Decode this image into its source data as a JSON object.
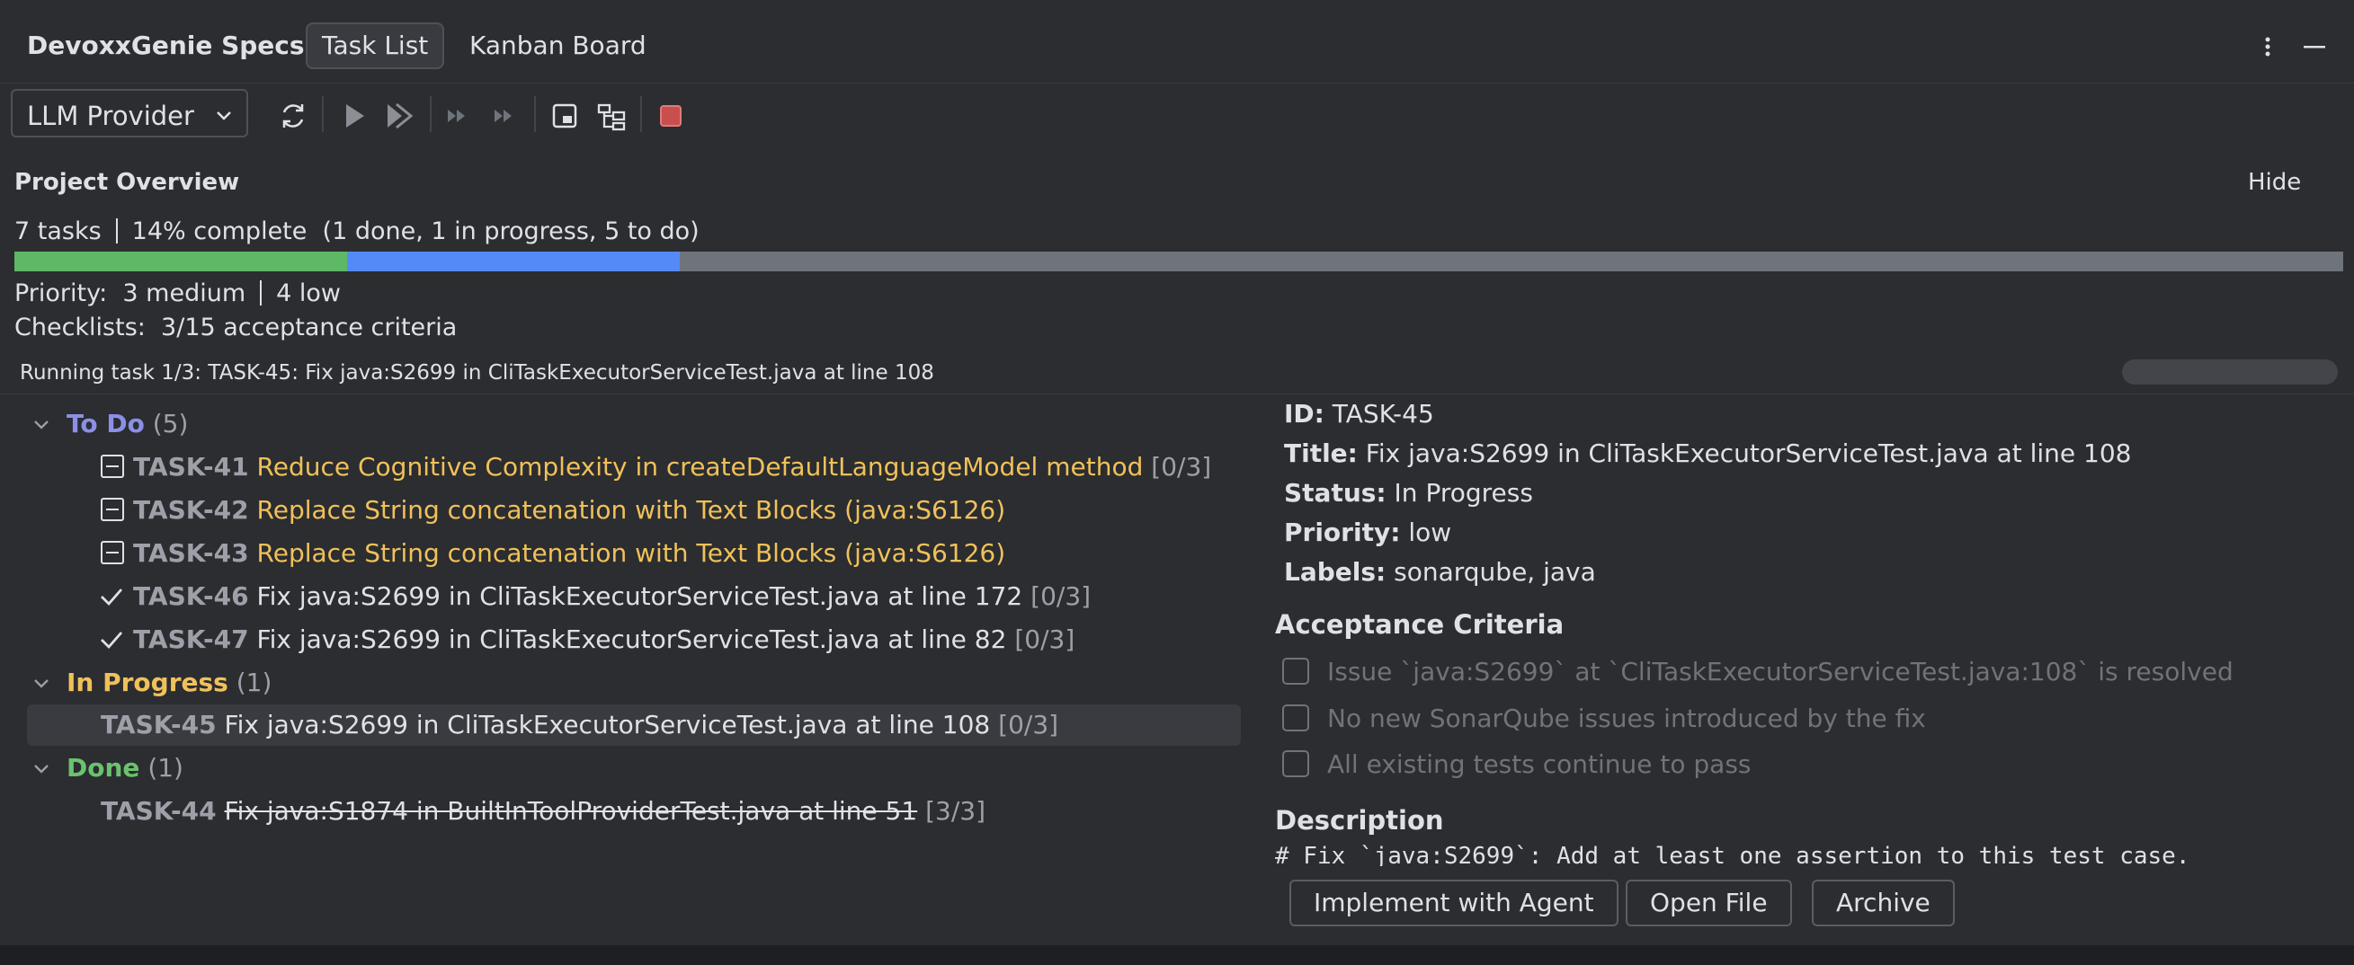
{
  "header": {
    "app_title": "DevoxxGenie Specs",
    "tabs": [
      {
        "label": "Task List",
        "active": true
      },
      {
        "label": "Kanban Board",
        "active": false
      }
    ]
  },
  "toolbar": {
    "provider_label": "LLM Provider",
    "icons": [
      "refresh-icon",
      "run-icon",
      "run-all-icon",
      "step-forward-icon",
      "fast-forward-icon",
      "panel-icon",
      "hierarchy-icon",
      "stop-icon"
    ]
  },
  "overview": {
    "title": "Project Overview",
    "hide_label": "Hide",
    "tasks_text": "7 tasks",
    "complete_text": "14% complete  (1 done, 1 in progress, 5 to do)",
    "progress": {
      "done_fraction": 0.1429,
      "in_progress_fraction": 0.1429
    },
    "priority_label": "Priority:",
    "priority_medium": "3 medium",
    "priority_low": "4 low",
    "checklists_text": "Checklists:  3/15 acceptance criteria",
    "running_text": "Running task 1/3: TASK-45: Fix java:S2699 in CliTaskExecutorServiceTest.java at line 108"
  },
  "tree": {
    "todo": {
      "name": "To Do",
      "count": "(5)"
    },
    "in_progress": {
      "name": "In Progress",
      "count": "(1)"
    },
    "done": {
      "name": "Done",
      "count": "(1)"
    },
    "tasks": [
      {
        "id": "TASK-41",
        "title": "Reduce Cognitive Complexity in createDefaultLanguageModel method",
        "count": "[0/3]"
      },
      {
        "id": "TASK-42",
        "title": "Replace String concatenation with Text Blocks (java:S6126)",
        "count": ""
      },
      {
        "id": "TASK-43",
        "title": "Replace String concatenation with Text Blocks (java:S6126)",
        "count": ""
      },
      {
        "id": "TASK-46",
        "title": "Fix java:S2699 in CliTaskExecutorServiceTest.java at line 172",
        "count": "[0/3]"
      },
      {
        "id": "TASK-47",
        "title": "Fix java:S2699 in CliTaskExecutorServiceTest.java at line 82",
        "count": "[0/3]"
      },
      {
        "id": "TASK-45",
        "title": "Fix java:S2699 in CliTaskExecutorServiceTest.java at line 108",
        "count": "[0/3]"
      },
      {
        "id": "TASK-44",
        "title": "Fix java:S1874 in BuiltInToolProviderTest.java at line 51",
        "count": "[3/3]"
      }
    ]
  },
  "detail": {
    "id_label": "ID:",
    "id_value": "TASK-45",
    "title_label": "Title:",
    "title_value": "Fix java:S2699 in CliTaskExecutorServiceTest.java at line 108",
    "status_label": "Status:",
    "status_value": "In Progress",
    "priority_label": "Priority:",
    "priority_value": "low",
    "labels_label": "Labels:",
    "labels_value": "sonarqube, java",
    "acceptance_heading": "Acceptance Criteria",
    "criteria": [
      "Issue `java:S2699` at `CliTaskExecutorServiceTest.java:108` is resolved",
      "No new SonarQube issues introduced by the fix",
      "All existing tests continue to pass"
    ],
    "description_heading": "Description",
    "description_text": "# Fix `java:S2699`: Add at least one assertion to this test case.",
    "buttons": {
      "implement": "Implement with Agent",
      "open_file": "Open File",
      "archive": "Archive"
    }
  },
  "colors": {
    "accent_todo": "#8c8fe8",
    "accent_progress": "#f0c15a",
    "accent_done": "#6ac26e",
    "progress_done": "#5fb865",
    "progress_active": "#548af7"
  }
}
